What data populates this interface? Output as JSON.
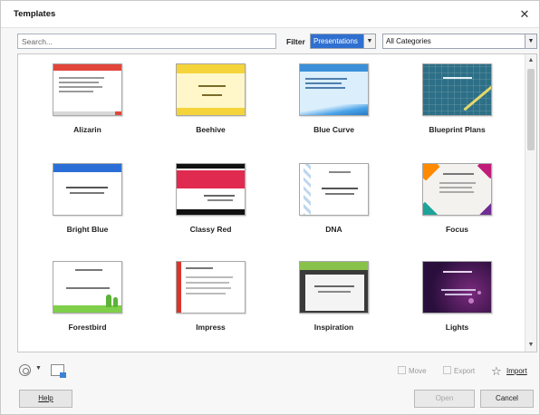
{
  "window": {
    "title": "Templates",
    "close_glyph": "✕"
  },
  "search": {
    "placeholder": "Search...",
    "value": ""
  },
  "filter": {
    "label": "Filter",
    "type_value": "Presentations",
    "category_value": "All Categories"
  },
  "templates": [
    {
      "name": "Alizarin"
    },
    {
      "name": "Beehive"
    },
    {
      "name": "Blue Curve"
    },
    {
      "name": "Blueprint Plans"
    },
    {
      "name": "Bright Blue"
    },
    {
      "name": "Classy Red"
    },
    {
      "name": "DNA"
    },
    {
      "name": "Focus"
    },
    {
      "name": "Forestbird"
    },
    {
      "name": "Impress"
    },
    {
      "name": "Inspiration"
    },
    {
      "name": "Lights"
    }
  ],
  "toolbar": {
    "move_label": "Move",
    "export_label": "Export",
    "import_label": "Import"
  },
  "buttons": {
    "help": "Help",
    "open": "Open",
    "cancel": "Cancel"
  },
  "icons": {
    "close": "close-icon",
    "settings": "gear-icon",
    "new_window": "browse-online-icon",
    "move": "move-icon",
    "export": "export-icon",
    "import": "star-import-icon"
  },
  "colors": {
    "accent": "#2f6fd0"
  }
}
